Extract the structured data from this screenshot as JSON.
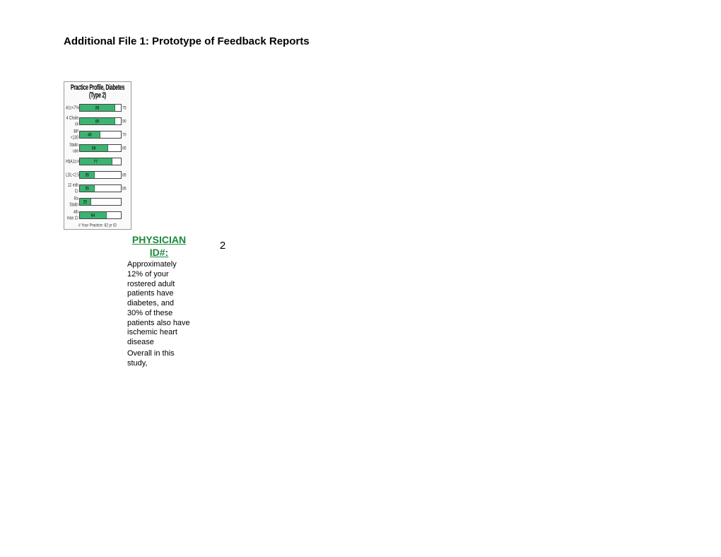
{
  "title": "Additional File 1: Prototype of Feedback Reports",
  "chart_data": {
    "type": "bar",
    "title": "Practice Profile, Diabetes (Type 2)",
    "footer": "# Your Practice: 82 yr ID",
    "bars": [
      {
        "label": "A1c<7%",
        "value": 85,
        "right": "75"
      },
      {
        "label": "4 Chole ck",
        "value": 85,
        "right": "90"
      },
      {
        "label": "BP <130",
        "value": 48,
        "right": "70"
      },
      {
        "label": "Statin use",
        "value": 68,
        "right": "85"
      },
      {
        "label": "HbA1c>8",
        "value": 77,
        "right": ""
      },
      {
        "label": "LDL<2.5",
        "value": 35,
        "right": "85"
      },
      {
        "label": "12 mth Cr",
        "value": 35,
        "right": "85"
      },
      {
        "label": "Rx Statin",
        "value": 25,
        "right": ""
      },
      {
        "label": "4th mon Cr",
        "value": 64,
        "right": ""
      }
    ]
  },
  "physician": {
    "label": "PHYSICIAN ID#:",
    "value": "2"
  },
  "paragraph1": "Approximately 12% of your rostered adult patients have diabetes, and 30% of these patients also have ischemic heart disease",
  "paragraph2": "Overall in this study,"
}
